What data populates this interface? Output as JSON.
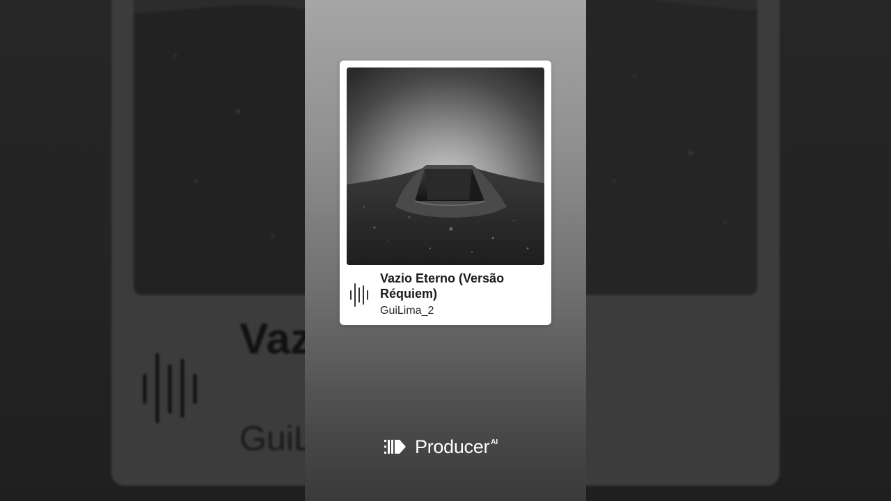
{
  "song": {
    "title": "Vazio Eterno (Versão Réquiem)",
    "artist": "GuiLima_2"
  },
  "background_echo": {
    "title_partial": "Vaz                    rsão Réc",
    "artist_partial": "GuiL"
  },
  "brand": {
    "name": "Producer",
    "suffix": "AI"
  },
  "icons": {
    "cover": "open-grave-image",
    "waveform": "waveform-icon",
    "logo": "producer-logo-icon"
  }
}
